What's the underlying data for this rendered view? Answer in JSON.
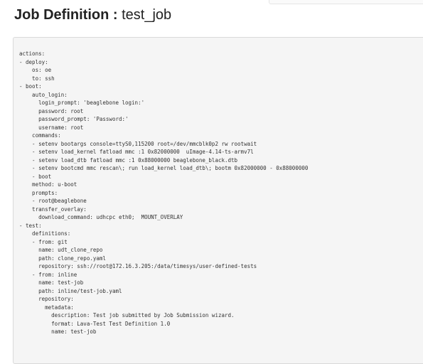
{
  "page": {
    "title_label": "Job Definition : ",
    "title_value": "test_job"
  },
  "job_definition": {
    "lines": [
      "actions:",
      "- deploy:",
      "    os: oe",
      "    to: ssh",
      "- boot:",
      "    auto_login:",
      "      login_prompt: 'beaglebone login:'",
      "      password: root",
      "      password_prompt: 'Password:'",
      "      username: root",
      "    commands:",
      "    - setenv bootargs console=ttyS0,115200 root=/dev/mmcblk0p2 rw rootwait",
      "    - setenv load_kernel fatload mmc :1 0x82000000  uImage-4.14-ts-armv7l",
      "    - setenv load_dtb fatload mmc :1 0x88000000 beaglebone_black.dtb",
      "    - setenv bootcmd mmc rescan\\; run load_kernel load_dtb\\; bootm 0x82000000 - 0x88000000",
      "    - boot",
      "    method: u-boot",
      "    prompts:",
      "    - root@beaglebone",
      "    transfer_overlay:",
      "      download_command: udhcpc eth0;  MOUNT_OVERLAY",
      "- test:",
      "    definitions:",
      "    - from: git",
      "      name: udt_clone_repo",
      "      path: clone_repo.yaml",
      "      repository: ssh://root@172.16.3.205:/data/timesys/user-defined-tests",
      "    - from: inline",
      "      name: test-job",
      "      path: inline/test-job.yaml",
      "      repository:",
      "        metadata:",
      "          description: Test job submitted by Job Submission wizard.",
      "          format: Lava-Test Test Definition 1.0",
      "          name: test-job"
    ]
  }
}
